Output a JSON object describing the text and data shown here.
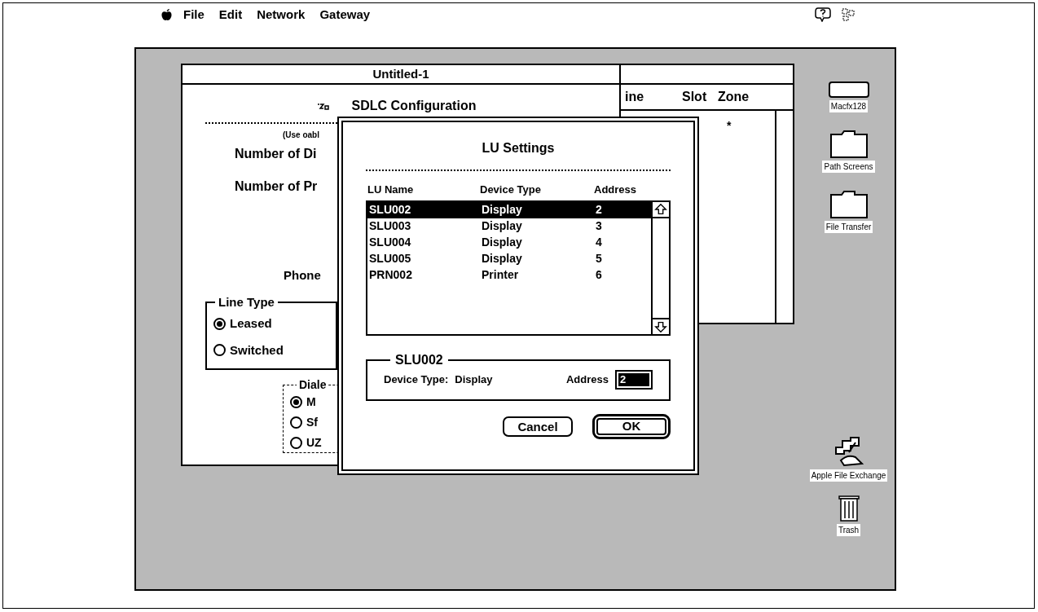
{
  "menu_bar": {
    "items": [
      "File",
      "Edit",
      "Network",
      "Gateway"
    ]
  },
  "back_window": {
    "columns": [
      "ine",
      "Slot",
      "Zone"
    ],
    "cell": "*"
  },
  "config_window": {
    "title": "Untitled-1",
    "heading": "SDLC Configuration",
    "note": "(Use oabl",
    "fields": [
      "Number of Di",
      "Number of Pr",
      "Phone"
    ],
    "line_type": {
      "label": "Line Type",
      "options": [
        {
          "label": "Leased",
          "selected": true
        },
        {
          "label": "Switched",
          "selected": false
        }
      ]
    },
    "dialing": {
      "label": "Diale",
      "options": [
        {
          "label": "M",
          "selected": true
        },
        {
          "label": "Sf",
          "selected": false
        },
        {
          "label": "UZ",
          "selected": false
        }
      ]
    }
  },
  "dialog": {
    "title": "LU Settings",
    "columns": [
      "LU Name",
      "Device Type",
      "Address"
    ],
    "rows": [
      {
        "name": "SLU002",
        "device_type": "Display",
        "address": "2",
        "selected": true
      },
      {
        "name": "SLU003",
        "device_type": "Display",
        "address": "3",
        "selected": false
      },
      {
        "name": "SLU004",
        "device_type": "Display",
        "address": "4",
        "selected": false
      },
      {
        "name": "SLU005",
        "device_type": "Display",
        "address": "5",
        "selected": false
      },
      {
        "name": "PRN002",
        "device_type": "Printer",
        "address": "6",
        "selected": false
      }
    ],
    "detail": {
      "title": "SLU002",
      "device_type_label": "Device Type:",
      "device_type": "Display",
      "address_label": "Address",
      "address": "2"
    },
    "buttons": [
      {
        "label": "Cancel",
        "default": false
      },
      {
        "label": "OK",
        "default": true
      }
    ]
  },
  "desktop_icons": [
    {
      "label": "Macfx128",
      "kind": "disk"
    },
    {
      "label": "Path Screens",
      "kind": "folder"
    },
    {
      "label": "File Transfer",
      "kind": "folder"
    },
    {
      "label": "Apple File Exchange",
      "kind": "app"
    },
    {
      "label": "Trash",
      "kind": "trash"
    }
  ]
}
